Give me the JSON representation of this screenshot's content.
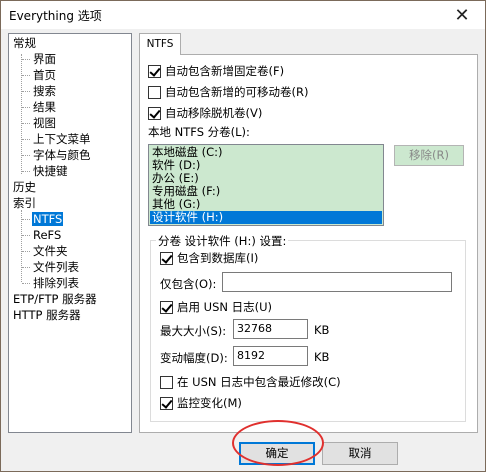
{
  "window": {
    "title": "Everything 选项",
    "close_glyph": "✕"
  },
  "tree": {
    "items": [
      {
        "label": "常规"
      },
      {
        "label": "界面"
      },
      {
        "label": "首页"
      },
      {
        "label": "搜索"
      },
      {
        "label": "结果"
      },
      {
        "label": "视图"
      },
      {
        "label": "上下文菜单"
      },
      {
        "label": "字体与颜色"
      },
      {
        "label": "快捷键"
      },
      {
        "label": "历史"
      },
      {
        "label": "索引"
      },
      {
        "label": "NTFS"
      },
      {
        "label": "ReFS"
      },
      {
        "label": "文件夹"
      },
      {
        "label": "文件列表"
      },
      {
        "label": "排除列表"
      },
      {
        "label": "ETP/FTP 服务器"
      },
      {
        "label": "HTTP 服务器"
      }
    ],
    "selected": "NTFS"
  },
  "tab": {
    "label": "NTFS"
  },
  "options": {
    "auto_include_fixed": {
      "label": "自动包含新增固定卷(F)",
      "checked": true
    },
    "auto_include_removable": {
      "label": "自动包含新增的可移动卷(R)",
      "checked": false
    },
    "auto_remove_offline": {
      "label": "自动移除脱机卷(V)",
      "checked": true
    }
  },
  "volumes": {
    "label": "本地 NTFS 分卷(L):",
    "items": [
      {
        "label": "本地磁盘 (C:)"
      },
      {
        "label": "软件 (D:)"
      },
      {
        "label": "办公 (E:)"
      },
      {
        "label": "专用磁盘 (F:)"
      },
      {
        "label": "其他 (G:)"
      },
      {
        "label": "设计软件 (H:)"
      }
    ],
    "selected": "设计软件 (H:)",
    "remove_button": "移除(R)"
  },
  "volume_settings": {
    "title": "分卷 设计软件 (H:) 设置:",
    "include_in_db": {
      "label": "包含到数据库(I)",
      "checked": true
    },
    "include_only_label": "仅包含(O):",
    "include_only_value": "",
    "enable_usn": {
      "label": "启用 USN 日志(U)",
      "checked": true
    },
    "max_size_label": "最大大小(S):",
    "max_size_value": "32768",
    "max_size_unit": "KB",
    "delta_label": "变动幅度(D):",
    "delta_value": "8192",
    "delta_unit": "KB",
    "include_recent": {
      "label": "在 USN 日志中包含最近修改(C)",
      "checked": false
    },
    "monitor_changes": {
      "label": "监控变化(M)",
      "checked": true
    }
  },
  "buttons": {
    "ok": "确定",
    "cancel": "取消"
  },
  "colors": {
    "accent": "#0078d7",
    "listbox_bg": "#cce8cf",
    "highlight_circle": "#e0302e"
  }
}
